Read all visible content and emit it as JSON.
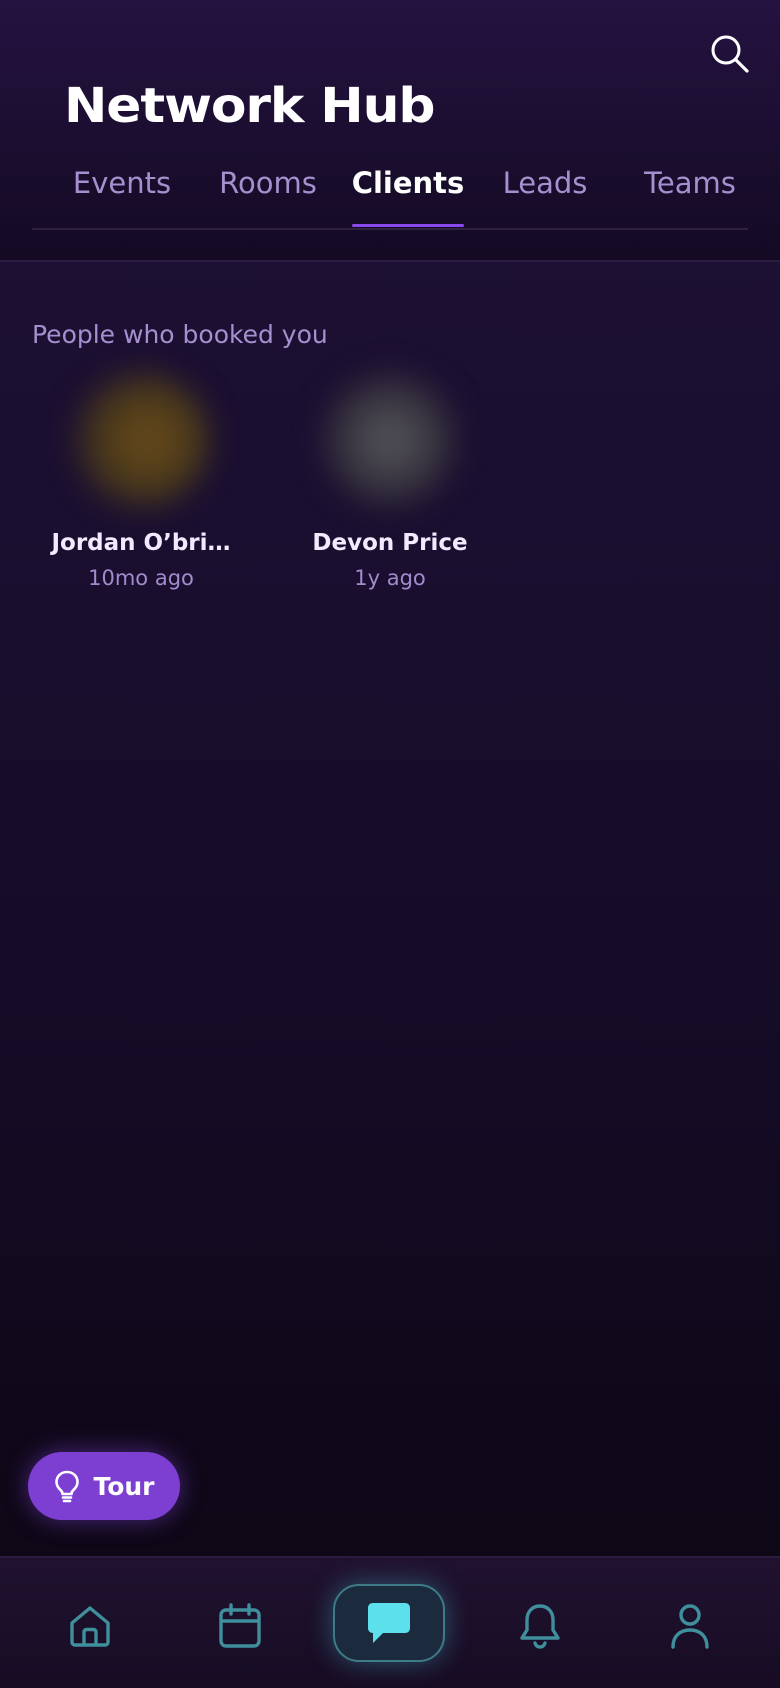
{
  "app": {
    "title": "Network Hub"
  },
  "tabs": [
    {
      "label": "Events",
      "active": false
    },
    {
      "label": "Rooms",
      "active": false
    },
    {
      "label": "Clients",
      "active": true
    },
    {
      "label": "Leads",
      "active": false
    },
    {
      "label": "Teams",
      "active": false
    }
  ],
  "clients_section": {
    "title": "People who booked you",
    "clients": [
      {
        "name": "Jordan O’bri…",
        "time": "10mo ago",
        "avatar_color": "#6b4a1c"
      },
      {
        "name": "Devon Price",
        "time": "1y ago",
        "avatar_color": "#4a4a52"
      }
    ]
  },
  "tour_button": {
    "label": "Tour",
    "icon": "lightbulb-icon",
    "color": "#7d3fd1"
  },
  "bottom_nav": [
    {
      "icon": "home-icon",
      "active": false
    },
    {
      "icon": "calendar-icon",
      "active": false
    },
    {
      "icon": "chat-icon",
      "active": true
    },
    {
      "icon": "bell-icon",
      "active": false
    },
    {
      "icon": "user-icon",
      "active": false
    }
  ],
  "colors": {
    "accent": "#8a49ee",
    "tab_inactive": "#a58fcf",
    "nav_icon": "#3f8f9c",
    "nav_active": "#5ce1ec"
  }
}
